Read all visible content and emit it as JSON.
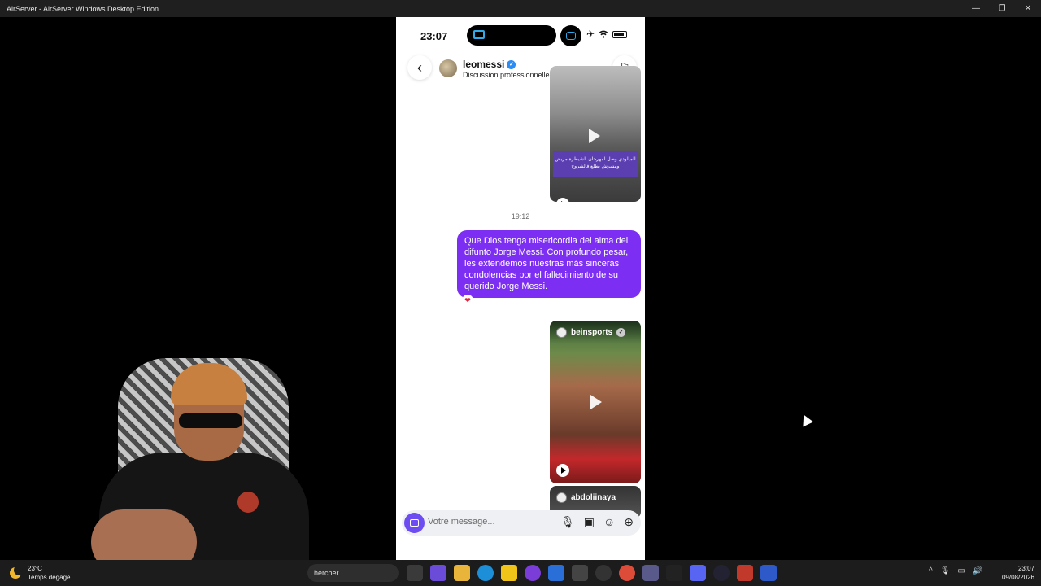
{
  "titlebar": {
    "title": "AirServer - AirServer Windows Desktop Edition",
    "minimize": "—",
    "maximize": "❐",
    "close": "✕"
  },
  "phone": {
    "status": {
      "time": "23:07",
      "airplane_icon": "✈",
      "wifi_icon": "wifi-icon"
    },
    "header": {
      "username": "leomessi",
      "subtitle": "Discussion professionnelle",
      "back_icon": "‹",
      "flag_icon": "⚐"
    },
    "media1": {
      "banner_text": "الميلودي وصل لمهرجان الشيطرة مريض ومشرش يطلع فالشروح"
    },
    "timestamp": "19:12",
    "message": "Que Dios tenga misericordia del alma del difunto Jorge Messi. Con profundo pesar, les extendemos nuestras más sinceras condolencias por el fallecimiento de su querido Jorge Messi.",
    "reaction": "❤",
    "media2": {
      "account": "beinsports"
    },
    "media3": {
      "account": "abdoliinaya"
    },
    "composer": {
      "placeholder": "Votre message...",
      "mic_icon": "🎙",
      "gallery_icon": "▣",
      "sticker_icon": "☺",
      "plus_icon": "⊕"
    }
  },
  "taskbar": {
    "weather_temp": "23°C",
    "weather_desc": "Temps dégagé",
    "search_text": "hercher",
    "clock_time": "23:07",
    "clock_date": "09/08/2026",
    "tray_up": "^",
    "tray_mic": "🎙",
    "tray_net": "▭",
    "tray_vol": "🔊"
  },
  "colors": {
    "accent_purple": "#7c2ff2",
    "camera_button": "#6d4cf2",
    "verified_blue": "#2a8cf5"
  }
}
